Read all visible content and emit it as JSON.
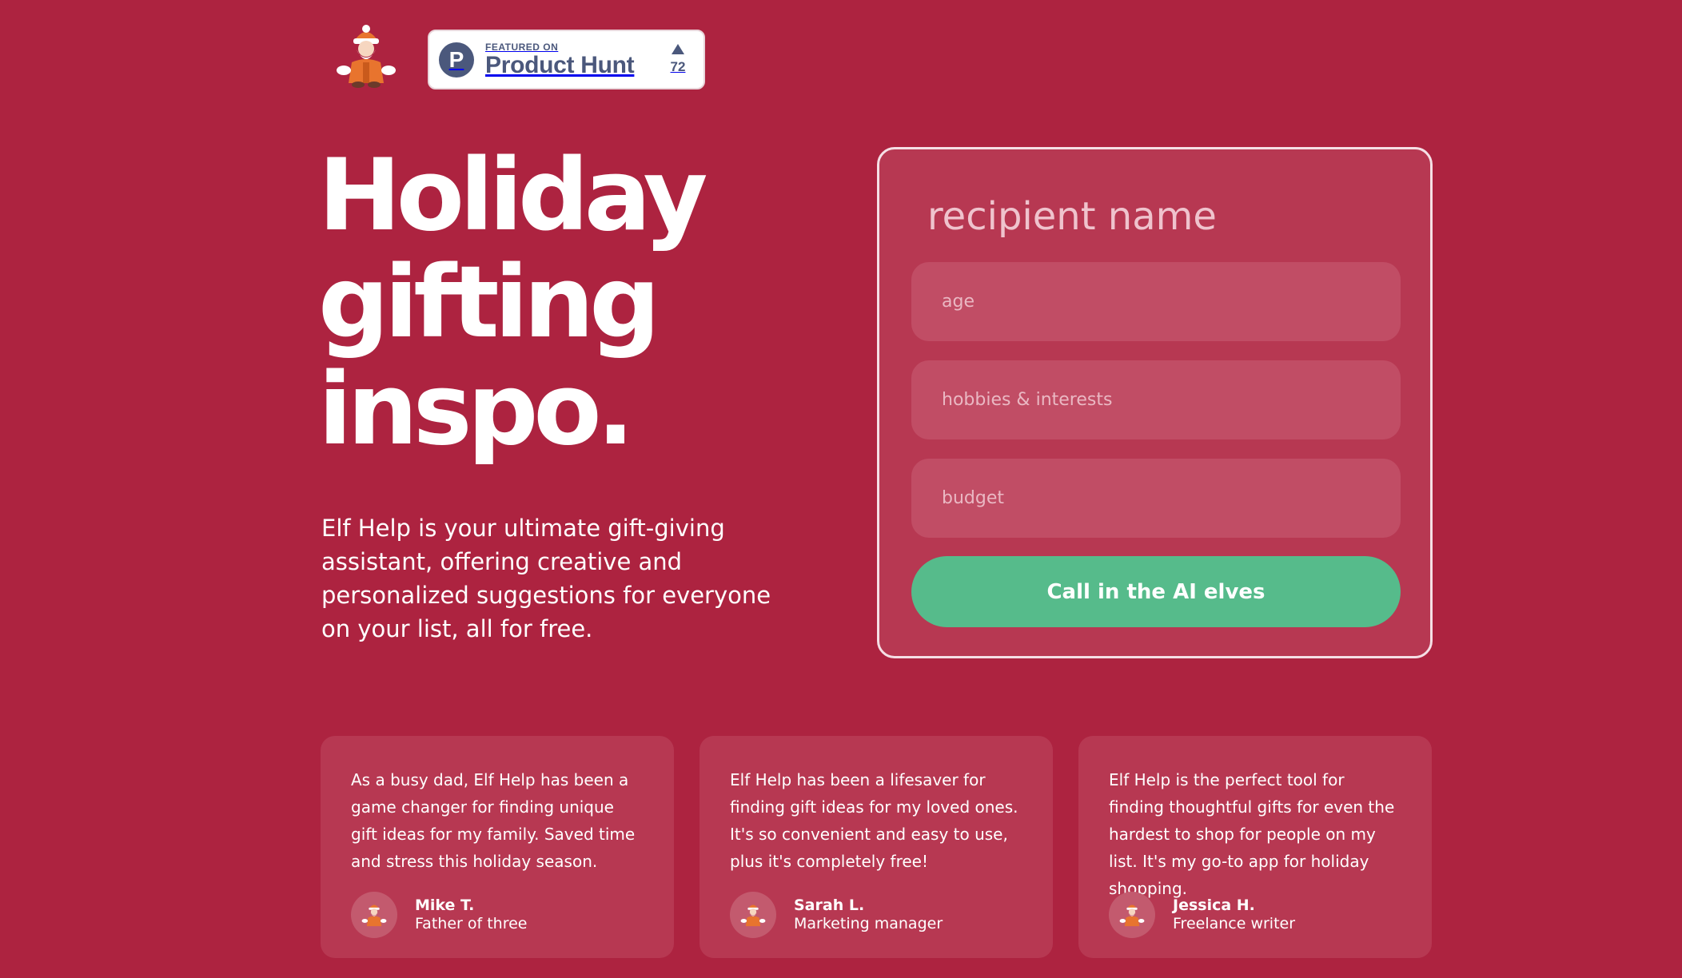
{
  "header": {
    "logo_icon": "santa-elf-icon",
    "product_hunt": {
      "featured_label": "FEATURED ON",
      "name": "Product Hunt",
      "logo_letter": "P",
      "upvote_icon": "upvote-triangle-icon",
      "vote_count": "72"
    }
  },
  "hero": {
    "title_line1": "Holiday",
    "title_line2": "gifting",
    "title_line3": "inspo.",
    "description": "Elf Help is your ultimate gift-giving assistant, offering creative and personalized suggestions for everyone on your list, all for free."
  },
  "form": {
    "name_placeholder": "recipient name",
    "age_placeholder": "age",
    "hobbies_placeholder": "hobbies & interests",
    "budget_placeholder": "budget",
    "submit_label": "Call in the AI elves"
  },
  "testimonials": [
    {
      "quote": "As a busy dad, Elf Help has been a game changer for finding unique gift ideas for my family. Saved time and stress this holiday season.",
      "name": "Mike T.",
      "role": "Father of three"
    },
    {
      "quote": "Elf Help has been a lifesaver for finding gift ideas for my loved ones. It's so convenient and easy to use, plus it's completely free!",
      "name": "Sarah L.",
      "role": "Marketing manager"
    },
    {
      "quote": "Elf Help is the perfect tool for finding thoughtful gifts for even the hardest to shop for people on my list. It's my go-to app for holiday shopping.",
      "name": "Jessica H.",
      "role": "Freelance writer"
    }
  ],
  "colors": {
    "background": "#ad2340",
    "card": "#b73852",
    "field": "#c14d65",
    "accent_green": "#56bb8b",
    "product_hunt": "#4b587c"
  }
}
